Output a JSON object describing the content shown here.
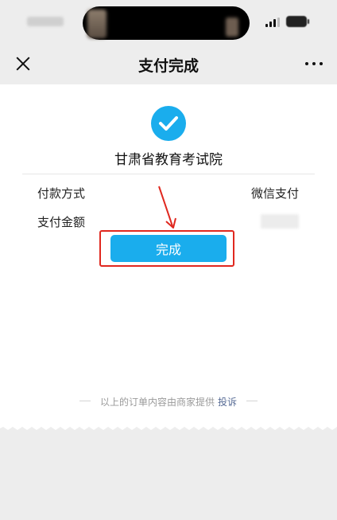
{
  "nav": {
    "title": "支付完成"
  },
  "receipt": {
    "merchant": "甘肃省教育考试院",
    "method_label": "付款方式",
    "method_value": "微信支付",
    "amount_label": "支付金额",
    "done_label": "完成"
  },
  "footer": {
    "text": "以上的订单内容由商家提供",
    "link": "投诉"
  },
  "colors": {
    "accent": "#1aaded",
    "annotation": "#e0281f",
    "link": "#576b95",
    "background": "#ededed"
  },
  "icons": [
    "close-icon",
    "more-icon",
    "check-icon",
    "signal-icon",
    "battery-icon"
  ]
}
